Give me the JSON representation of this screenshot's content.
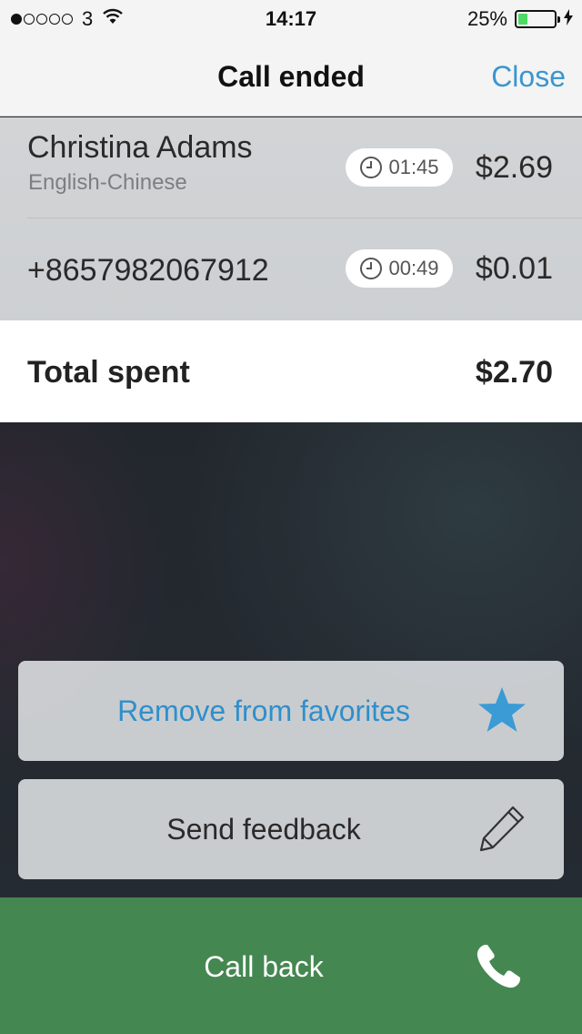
{
  "status_bar": {
    "carrier": "3",
    "time": "14:17",
    "battery": "25%",
    "battery_level": 0.25,
    "signal_dots_filled": 1,
    "signal_dots_total": 5
  },
  "nav": {
    "title": "Call ended",
    "close_label": "Close"
  },
  "calls": [
    {
      "name": "Christina Adams",
      "language": "English-Chinese",
      "duration": "01:45",
      "cost": "$2.69"
    },
    {
      "name": "+8657982067912",
      "language": "",
      "duration": "00:49",
      "cost": "$0.01"
    }
  ],
  "total": {
    "label": "Total spent",
    "amount": "$2.70"
  },
  "actions": {
    "favorites_label": "Remove from favorites",
    "favorites_icon": "star-icon",
    "feedback_label": "Send feedback",
    "feedback_icon": "pencil-icon"
  },
  "callback": {
    "label": "Call back",
    "icon": "phone-icon"
  },
  "colors": {
    "accent": "#3a96d0",
    "callback_green": "#458751",
    "battery_green": "#4cd964"
  }
}
